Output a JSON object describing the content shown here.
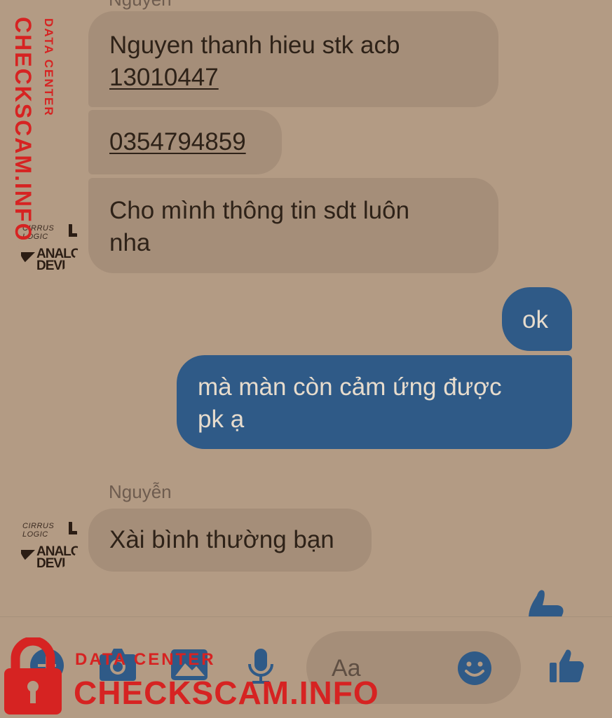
{
  "messages": {
    "top_sender_partial": "Nguyễn",
    "in_1": {
      "text": "Nguyen thanh hieu stk acb",
      "number": "13010447"
    },
    "in_2": {
      "number": "0354794859"
    },
    "in_3": {
      "line1": "Cho mình thông tin sdt luôn",
      "line2": "nha"
    },
    "out_1": "ok",
    "out_2": {
      "line1": "mà màn còn cảm ứng được",
      "line2": "pk ạ"
    },
    "sender_name": "Nguyễn",
    "in_4": "Xài bình thường bạn"
  },
  "avatar": {
    "line1": "CIRRUS LOGIC",
    "line2": "ANALO",
    "line3": "DEVI"
  },
  "composer": {
    "placeholder": "Aa"
  },
  "watermark": {
    "vertical_small": "DATA CENTER",
    "vertical_big": "CHECKSCAM.INFO",
    "bottom_small": "DATA CENTER",
    "bottom_big": "CHECKSCAM.INFO"
  },
  "colors": {
    "background": "#b39b84",
    "incoming_bubble": "#a58e79",
    "outgoing_bubble": "#2f5a87",
    "accent": "#2f5a87",
    "watermark": "#d62322"
  },
  "icons": [
    "plus-icon",
    "camera-icon",
    "image-icon",
    "microphone-icon",
    "emoji-icon",
    "thumbs-up-icon",
    "lock-icon"
  ]
}
